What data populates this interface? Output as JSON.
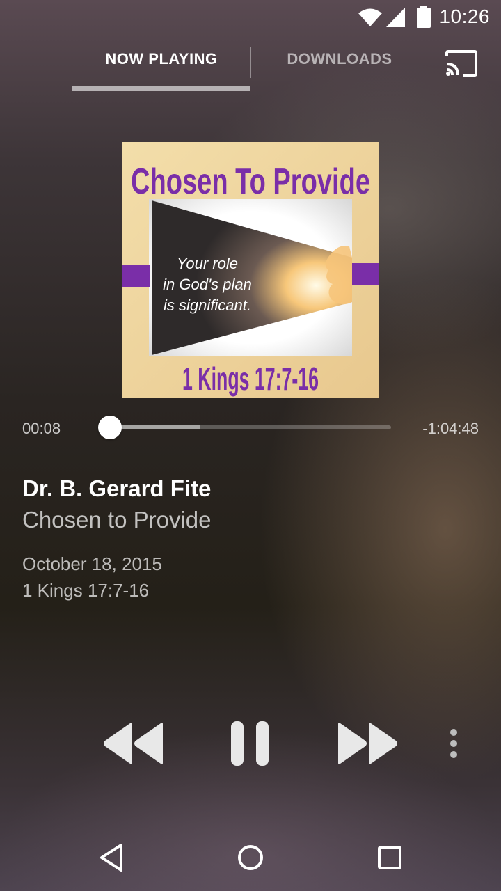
{
  "status": {
    "time": "10:26"
  },
  "tabs": {
    "now_playing": "NOW PLAYING",
    "downloads": "DOWNLOADS"
  },
  "album_art": {
    "heading": "Chosen To Provide",
    "caption_lines": [
      "Your role",
      "in God's plan",
      "is significant."
    ],
    "reference": "1 Kings 17:7-16"
  },
  "player": {
    "elapsed": "00:08",
    "remaining": "-1:04:48",
    "progress": 0.0,
    "buffered": 0.32
  },
  "track": {
    "speaker": "Dr. B. Gerard Fite",
    "title": "Chosen to Provide",
    "date": "October 18, 2015",
    "passage": "1 Kings 17:7-16"
  },
  "colors": {
    "art_purple": "#7a2ea8",
    "art_wood": "#f0d7a0"
  }
}
